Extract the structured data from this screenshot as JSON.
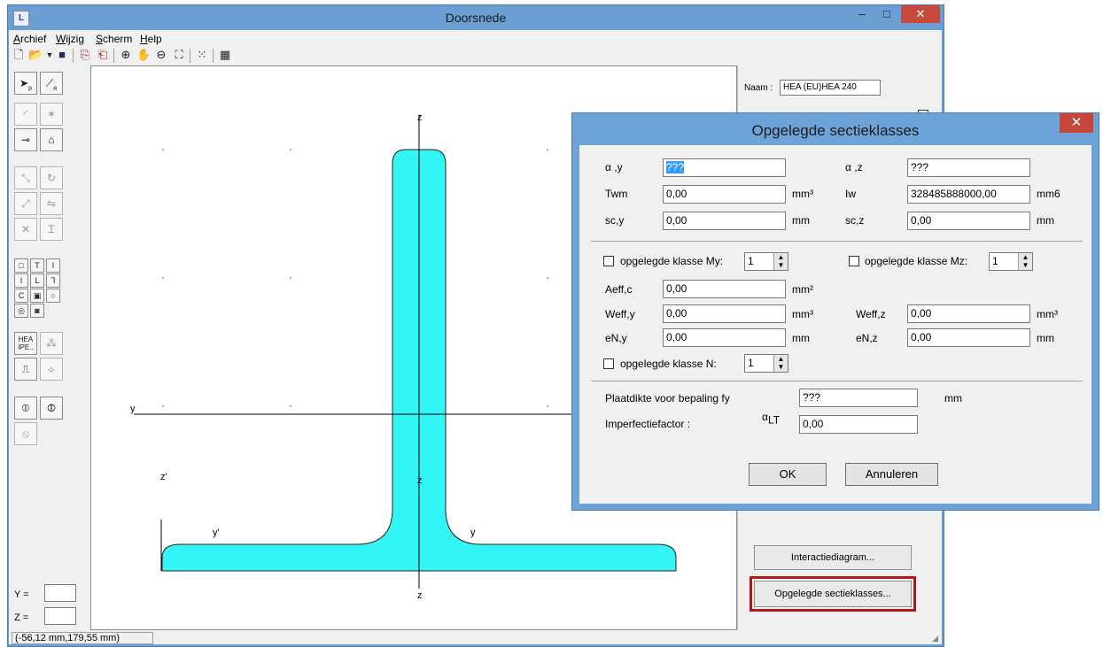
{
  "window": {
    "title": "Doorsnede",
    "minimize": "–",
    "maximize": "□",
    "close": "✕"
  },
  "menu": [
    {
      "label": "Archief",
      "key": "A"
    },
    {
      "label": "Wijzig",
      "key": "W"
    },
    {
      "label": "Scherm",
      "key": "S"
    },
    {
      "label": "Help",
      "key": "H"
    }
  ],
  "toolbar_icons": [
    "new-icon",
    "open-icon",
    "save-icon",
    "copy-icon",
    "paste-icon",
    "zoom-in-icon",
    "pan-icon",
    "zoom-out-icon",
    "zoom-fit-icon",
    "grid-icon",
    "calculator-icon"
  ],
  "leftpanel": {
    "y_label": "Y =",
    "z_label": "Z =",
    "profile_tool_label": "HEA IPE..",
    "select_sub": "p",
    "line_sub": "a"
  },
  "canvas": {
    "labels": {
      "z_top": "z",
      "z_mid": "z",
      "z_bottom": "z",
      "y_left": "y",
      "y_right": "y",
      "y_prime": "y'",
      "z_prime": "z'"
    },
    "profile_fill": "#33f5f5"
  },
  "rightpanel": {
    "naam_label": "Naam :",
    "naam_value": "HEA (EU)HEA 240",
    "interactiediagram_button": "Interactiediagram...",
    "sectieklasses_button": "Opgelegde sectieklasses..."
  },
  "status": {
    "coords": "(-56,12 mm,179,55 mm)"
  },
  "dialog": {
    "title": "Opgelegde sectieklasses",
    "close": "✕",
    "alpha_y_label": "α ,y",
    "alpha_y_value": "???",
    "alpha_z_label": "α ,z",
    "alpha_z_value": "???",
    "twm_label": "Twm",
    "twm_value": "0,00",
    "twm_unit": "mm³",
    "iw_label": "Iw",
    "iw_value": "328485888000,00",
    "iw_unit": "mm6",
    "scy_label": "sc,y",
    "scy_value": "0,00",
    "scy_unit": "mm",
    "scz_label": "sc,z",
    "scz_value": "0,00",
    "scz_unit": "mm",
    "klasse_my_label": "opgelegde klasse My:",
    "klasse_my_value": "1",
    "klasse_mz_label": "opgelegde klasse Mz:",
    "klasse_mz_value": "1",
    "aeffc_label": "Aeff,c",
    "aeffc_value": "0,00",
    "aeffc_unit": "mm²",
    "weffy_label": "Weff,y",
    "weffy_value": "0,00",
    "weffy_unit": "mm³",
    "weffz_label": "Weff,z",
    "weffz_value": "0,00",
    "weffz_unit": "mm³",
    "eny_label": "eN,y",
    "eny_value": "0,00",
    "eny_unit": "mm",
    "enz_label": "eN,z",
    "enz_value": "0,00",
    "enz_unit": "mm",
    "klasse_n_label": "opgelegde klasse N:",
    "klasse_n_value": "1",
    "plaatdikte_label": "Plaatdikte voor bepaling fy",
    "plaatdikte_value": "???",
    "plaatdikte_unit": "mm",
    "imperfectie_label": "Imperfectiefactor :",
    "alpha_lt_symbol": "α",
    "alpha_lt_sub": "LT",
    "imperfectie_value": "0,00",
    "ok_label": "OK",
    "cancel_label": "Annuleren"
  }
}
